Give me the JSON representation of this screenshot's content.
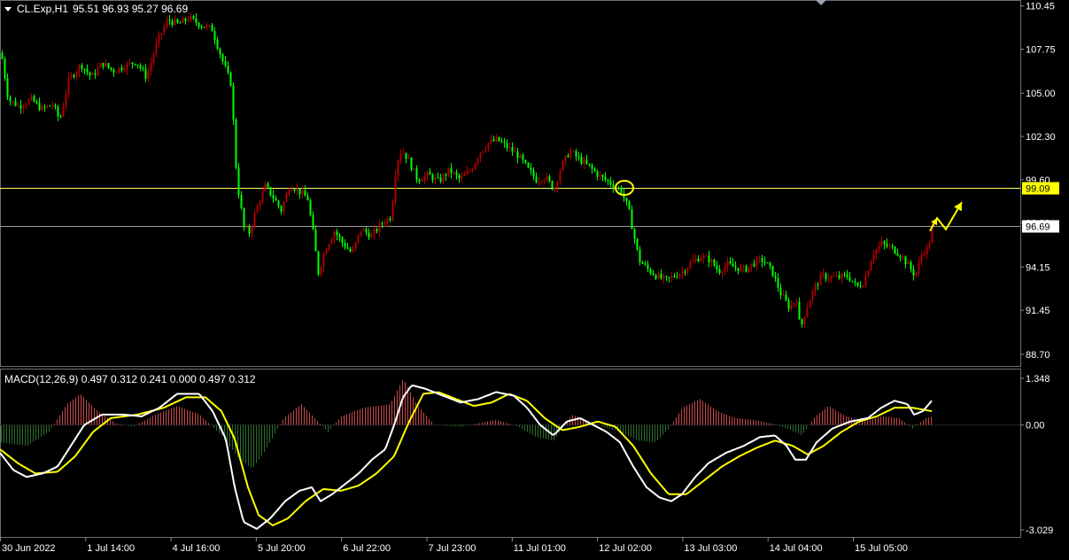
{
  "header": {
    "symbol": "CL.Exp,H1",
    "ohlc": "95.51 96.93 95.27 96.69"
  },
  "colors": {
    "background": "#000000",
    "grid": "#5a5a5a",
    "bull_candle": "#b00000",
    "bear_candle": "#00ff00",
    "macd_line": "#ffffff",
    "signal_line": "#ffff00",
    "hist_positive": "#c84848",
    "hist_negative": "#2c6e2c",
    "level_line": "#ffff66",
    "current_price_line": "#9a9a9a",
    "annotation": "#ffff00"
  },
  "chart_data": [
    {
      "type": "candlestick",
      "name": "price",
      "price_axis": {
        "ticks": [
          "110.45",
          "107.75",
          "105.00",
          "102.30",
          "99.60",
          "96.90",
          "94.15",
          "91.45",
          "88.70"
        ],
        "ylim": [
          88.25,
          110.6
        ]
      },
      "time_axis": {
        "ticks": [
          "30 Jun 2022",
          "1 Jul 14:00",
          "4 Jul 16:00",
          "5 Jul 20:00",
          "6 Jul 22:00",
          "7 Jul 23:00",
          "11 Jul 01:00",
          "12 Jul 02:00",
          "13 Jul 03:00",
          "14 Jul 04:00",
          "15 Jul 05:00"
        ]
      },
      "levels": [
        {
          "price": 99.09,
          "label": "99.09",
          "style": "yellow"
        },
        {
          "price": 96.69,
          "label": "96.69",
          "style": "current"
        }
      ],
      "anchors": [
        {
          "x": 0,
          "y": 107.5
        },
        {
          "x": 8,
          "y": 104.6
        },
        {
          "x": 20,
          "y": 104.2
        },
        {
          "x": 34,
          "y": 104.6
        },
        {
          "x": 46,
          "y": 104.0
        },
        {
          "x": 58,
          "y": 104.3
        },
        {
          "x": 66,
          "y": 103.3
        },
        {
          "x": 76,
          "y": 105.8
        },
        {
          "x": 90,
          "y": 106.8
        },
        {
          "x": 102,
          "y": 106.0
        },
        {
          "x": 114,
          "y": 106.9
        },
        {
          "x": 126,
          "y": 106.4
        },
        {
          "x": 140,
          "y": 106.7
        },
        {
          "x": 152,
          "y": 107.0
        },
        {
          "x": 164,
          "y": 106.0
        },
        {
          "x": 176,
          "y": 108.2
        },
        {
          "x": 188,
          "y": 109.6
        },
        {
          "x": 200,
          "y": 109.3
        },
        {
          "x": 212,
          "y": 109.7
        },
        {
          "x": 224,
          "y": 109.3
        },
        {
          "x": 238,
          "y": 109.0
        },
        {
          "x": 250,
          "y": 107.0
        },
        {
          "x": 260,
          "y": 105.5
        },
        {
          "x": 264,
          "y": 101.0
        },
        {
          "x": 268,
          "y": 98.8
        },
        {
          "x": 274,
          "y": 96.6
        },
        {
          "x": 280,
          "y": 96.3
        },
        {
          "x": 288,
          "y": 97.8
        },
        {
          "x": 298,
          "y": 99.2
        },
        {
          "x": 306,
          "y": 98.6
        },
        {
          "x": 316,
          "y": 97.7
        },
        {
          "x": 326,
          "y": 99.3
        },
        {
          "x": 336,
          "y": 98.9
        },
        {
          "x": 346,
          "y": 98.4
        },
        {
          "x": 352,
          "y": 96.3
        },
        {
          "x": 358,
          "y": 93.8
        },
        {
          "x": 366,
          "y": 95.3
        },
        {
          "x": 376,
          "y": 96.4
        },
        {
          "x": 386,
          "y": 95.6
        },
        {
          "x": 396,
          "y": 95.0
        },
        {
          "x": 406,
          "y": 96.5
        },
        {
          "x": 418,
          "y": 96.1
        },
        {
          "x": 430,
          "y": 96.9
        },
        {
          "x": 440,
          "y": 97.3
        },
        {
          "x": 446,
          "y": 100.6
        },
        {
          "x": 452,
          "y": 101.5
        },
        {
          "x": 460,
          "y": 100.8
        },
        {
          "x": 470,
          "y": 99.6
        },
        {
          "x": 482,
          "y": 99.9
        },
        {
          "x": 494,
          "y": 99.5
        },
        {
          "x": 506,
          "y": 100.2
        },
        {
          "x": 518,
          "y": 99.6
        },
        {
          "x": 530,
          "y": 100.2
        },
        {
          "x": 540,
          "y": 101.3
        },
        {
          "x": 550,
          "y": 101.9
        },
        {
          "x": 560,
          "y": 102.1
        },
        {
          "x": 572,
          "y": 101.6
        },
        {
          "x": 584,
          "y": 101.1
        },
        {
          "x": 594,
          "y": 100.3
        },
        {
          "x": 604,
          "y": 99.6
        },
        {
          "x": 614,
          "y": 99.8
        },
        {
          "x": 624,
          "y": 99.0
        },
        {
          "x": 632,
          "y": 100.4
        },
        {
          "x": 642,
          "y": 101.4
        },
        {
          "x": 652,
          "y": 100.9
        },
        {
          "x": 664,
          "y": 100.4
        },
        {
          "x": 676,
          "y": 99.8
        },
        {
          "x": 688,
          "y": 99.4
        },
        {
          "x": 700,
          "y": 98.9
        },
        {
          "x": 708,
          "y": 97.8
        },
        {
          "x": 714,
          "y": 96.2
        },
        {
          "x": 720,
          "y": 94.6
        },
        {
          "x": 730,
          "y": 94.0
        },
        {
          "x": 740,
          "y": 93.6
        },
        {
          "x": 750,
          "y": 93.3
        },
        {
          "x": 760,
          "y": 93.6
        },
        {
          "x": 770,
          "y": 93.9
        },
        {
          "x": 780,
          "y": 94.5
        },
        {
          "x": 790,
          "y": 94.8
        },
        {
          "x": 800,
          "y": 94.6
        },
        {
          "x": 810,
          "y": 93.9
        },
        {
          "x": 820,
          "y": 94.3
        },
        {
          "x": 830,
          "y": 94.1
        },
        {
          "x": 840,
          "y": 94.0
        },
        {
          "x": 850,
          "y": 94.4
        },
        {
          "x": 860,
          "y": 94.6
        },
        {
          "x": 870,
          "y": 93.9
        },
        {
          "x": 880,
          "y": 92.5
        },
        {
          "x": 890,
          "y": 91.6
        },
        {
          "x": 898,
          "y": 92.2
        },
        {
          "x": 902,
          "y": 90.2
        },
        {
          "x": 908,
          "y": 91.4
        },
        {
          "x": 916,
          "y": 92.6
        },
        {
          "x": 926,
          "y": 93.6
        },
        {
          "x": 936,
          "y": 93.5
        },
        {
          "x": 946,
          "y": 93.5
        },
        {
          "x": 956,
          "y": 93.6
        },
        {
          "x": 966,
          "y": 92.9
        },
        {
          "x": 974,
          "y": 93.2
        },
        {
          "x": 984,
          "y": 95.0
        },
        {
          "x": 994,
          "y": 95.6
        },
        {
          "x": 1006,
          "y": 95.3
        },
        {
          "x": 1016,
          "y": 94.9
        },
        {
          "x": 1026,
          "y": 94.1
        },
        {
          "x": 1032,
          "y": 93.6
        },
        {
          "x": 1040,
          "y": 95.1
        },
        {
          "x": 1046,
          "y": 95.3
        },
        {
          "x": 1052,
          "y": 96.69
        }
      ],
      "forecast_arrow": [
        {
          "x": 1050,
          "y": 96.4
        },
        {
          "x": 1058,
          "y": 97.2
        },
        {
          "x": 1068,
          "y": 96.5
        },
        {
          "x": 1086,
          "y": 98.2
        }
      ],
      "highlight_circle": {
        "x": 705,
        "y": 99.09
      }
    },
    {
      "type": "macd",
      "label": "MACD(12,26,9) 0.497 0.312 0.241 0.000 0.497 0.312",
      "params": [
        12,
        26,
        9
      ],
      "values": {
        "macd": 0.497,
        "signal": 0.312,
        "histogram": 0.241,
        "zero": 0.0
      },
      "y_axis": {
        "ticks": [
          "1.348",
          "0.00",
          "-3.029"
        ],
        "ylim": [
          -3.029,
          1.348
        ]
      },
      "macd_points": [
        {
          "x": 0,
          "y": -0.8
        },
        {
          "x": 15,
          "y": -1.3
        },
        {
          "x": 30,
          "y": -1.5
        },
        {
          "x": 48,
          "y": -1.4
        },
        {
          "x": 65,
          "y": -1.2
        },
        {
          "x": 80,
          "y": -0.6
        },
        {
          "x": 95,
          "y": 0.0
        },
        {
          "x": 115,
          "y": 0.3
        },
        {
          "x": 140,
          "y": 0.3
        },
        {
          "x": 160,
          "y": 0.25
        },
        {
          "x": 180,
          "y": 0.5
        },
        {
          "x": 200,
          "y": 0.9
        },
        {
          "x": 225,
          "y": 0.9
        },
        {
          "x": 240,
          "y": 0.4
        },
        {
          "x": 255,
          "y": -0.4
        },
        {
          "x": 265,
          "y": -1.8
        },
        {
          "x": 275,
          "y": -2.8
        },
        {
          "x": 290,
          "y": -3.0
        },
        {
          "x": 305,
          "y": -2.7
        },
        {
          "x": 322,
          "y": -2.2
        },
        {
          "x": 338,
          "y": -1.9
        },
        {
          "x": 352,
          "y": -1.8
        },
        {
          "x": 362,
          "y": -2.2
        },
        {
          "x": 375,
          "y": -2.0
        },
        {
          "x": 390,
          "y": -1.7
        },
        {
          "x": 405,
          "y": -1.4
        },
        {
          "x": 420,
          "y": -1.0
        },
        {
          "x": 435,
          "y": -0.7
        },
        {
          "x": 445,
          "y": 0.0
        },
        {
          "x": 455,
          "y": 0.8
        },
        {
          "x": 465,
          "y": 1.15
        },
        {
          "x": 480,
          "y": 1.05
        },
        {
          "x": 500,
          "y": 0.85
        },
        {
          "x": 520,
          "y": 0.65
        },
        {
          "x": 540,
          "y": 0.75
        },
        {
          "x": 560,
          "y": 0.95
        },
        {
          "x": 580,
          "y": 0.85
        },
        {
          "x": 595,
          "y": 0.5
        },
        {
          "x": 610,
          "y": 0.0
        },
        {
          "x": 625,
          "y": -0.3
        },
        {
          "x": 640,
          "y": 0.1
        },
        {
          "x": 655,
          "y": 0.2
        },
        {
          "x": 670,
          "y": 0.0
        },
        {
          "x": 685,
          "y": -0.2
        },
        {
          "x": 700,
          "y": -0.5
        },
        {
          "x": 715,
          "y": -1.2
        },
        {
          "x": 730,
          "y": -1.8
        },
        {
          "x": 745,
          "y": -2.1
        },
        {
          "x": 758,
          "y": -2.2
        },
        {
          "x": 770,
          "y": -2.0
        },
        {
          "x": 785,
          "y": -1.5
        },
        {
          "x": 800,
          "y": -1.1
        },
        {
          "x": 820,
          "y": -0.8
        },
        {
          "x": 840,
          "y": -0.6
        },
        {
          "x": 858,
          "y": -0.35
        },
        {
          "x": 875,
          "y": -0.3
        },
        {
          "x": 888,
          "y": -0.6
        },
        {
          "x": 898,
          "y": -1.0
        },
        {
          "x": 910,
          "y": -1.0
        },
        {
          "x": 922,
          "y": -0.5
        },
        {
          "x": 940,
          "y": -0.1
        },
        {
          "x": 960,
          "y": 0.1
        },
        {
          "x": 980,
          "y": 0.2
        },
        {
          "x": 995,
          "y": 0.5
        },
        {
          "x": 1010,
          "y": 0.7
        },
        {
          "x": 1025,
          "y": 0.6
        },
        {
          "x": 1032,
          "y": 0.3
        },
        {
          "x": 1042,
          "y": 0.4
        },
        {
          "x": 1052,
          "y": 0.7
        }
      ],
      "signal_points": [
        {
          "x": 0,
          "y": -0.7
        },
        {
          "x": 20,
          "y": -1.1
        },
        {
          "x": 40,
          "y": -1.4
        },
        {
          "x": 65,
          "y": -1.35
        },
        {
          "x": 85,
          "y": -0.9
        },
        {
          "x": 105,
          "y": -0.2
        },
        {
          "x": 125,
          "y": 0.2
        },
        {
          "x": 155,
          "y": 0.3
        },
        {
          "x": 185,
          "y": 0.5
        },
        {
          "x": 210,
          "y": 0.8
        },
        {
          "x": 232,
          "y": 0.8
        },
        {
          "x": 250,
          "y": 0.4
        },
        {
          "x": 265,
          "y": -0.4
        },
        {
          "x": 280,
          "y": -1.8
        },
        {
          "x": 292,
          "y": -2.6
        },
        {
          "x": 308,
          "y": -2.9
        },
        {
          "x": 325,
          "y": -2.7
        },
        {
          "x": 345,
          "y": -2.2
        },
        {
          "x": 365,
          "y": -1.85
        },
        {
          "x": 385,
          "y": -1.9
        },
        {
          "x": 405,
          "y": -1.75
        },
        {
          "x": 425,
          "y": -1.4
        },
        {
          "x": 445,
          "y": -0.9
        },
        {
          "x": 462,
          "y": 0.1
        },
        {
          "x": 478,
          "y": 0.9
        },
        {
          "x": 495,
          "y": 0.95
        },
        {
          "x": 515,
          "y": 0.75
        },
        {
          "x": 535,
          "y": 0.55
        },
        {
          "x": 555,
          "y": 0.65
        },
        {
          "x": 575,
          "y": 0.9
        },
        {
          "x": 595,
          "y": 0.7
        },
        {
          "x": 615,
          "y": 0.2
        },
        {
          "x": 635,
          "y": -0.15
        },
        {
          "x": 655,
          "y": -0.05
        },
        {
          "x": 675,
          "y": 0.1
        },
        {
          "x": 695,
          "y": -0.05
        },
        {
          "x": 715,
          "y": -0.6
        },
        {
          "x": 735,
          "y": -1.4
        },
        {
          "x": 755,
          "y": -2.0
        },
        {
          "x": 775,
          "y": -2.0
        },
        {
          "x": 795,
          "y": -1.6
        },
        {
          "x": 815,
          "y": -1.2
        },
        {
          "x": 835,
          "y": -0.9
        },
        {
          "x": 855,
          "y": -0.65
        },
        {
          "x": 875,
          "y": -0.45
        },
        {
          "x": 895,
          "y": -0.6
        },
        {
          "x": 912,
          "y": -0.85
        },
        {
          "x": 930,
          "y": -0.6
        },
        {
          "x": 950,
          "y": -0.2
        },
        {
          "x": 970,
          "y": 0.1
        },
        {
          "x": 990,
          "y": 0.25
        },
        {
          "x": 1010,
          "y": 0.5
        },
        {
          "x": 1030,
          "y": 0.5
        },
        {
          "x": 1052,
          "y": 0.4
        }
      ],
      "histogram_points": [
        {
          "x": 0,
          "y": -0.5
        },
        {
          "x": 30,
          "y": -0.6
        },
        {
          "x": 55,
          "y": -0.2
        },
        {
          "x": 75,
          "y": 0.6
        },
        {
          "x": 90,
          "y": 0.9
        },
        {
          "x": 110,
          "y": 0.4
        },
        {
          "x": 130,
          "y": 0.05
        },
        {
          "x": 150,
          "y": -0.05
        },
        {
          "x": 175,
          "y": 0.3
        },
        {
          "x": 200,
          "y": 0.55
        },
        {
          "x": 225,
          "y": 0.3
        },
        {
          "x": 250,
          "y": -0.3
        },
        {
          "x": 270,
          "y": -1.0
        },
        {
          "x": 285,
          "y": -1.25
        },
        {
          "x": 300,
          "y": -0.7
        },
        {
          "x": 320,
          "y": 0.2
        },
        {
          "x": 340,
          "y": 0.6
        },
        {
          "x": 355,
          "y": 0.2
        },
        {
          "x": 370,
          "y": -0.2
        },
        {
          "x": 385,
          "y": 0.25
        },
        {
          "x": 410,
          "y": 0.5
        },
        {
          "x": 440,
          "y": 0.6
        },
        {
          "x": 455,
          "y": 1.35
        },
        {
          "x": 470,
          "y": 0.6
        },
        {
          "x": 490,
          "y": 0.0
        },
        {
          "x": 520,
          "y": -0.05
        },
        {
          "x": 540,
          "y": 0.05
        },
        {
          "x": 560,
          "y": 0.15
        },
        {
          "x": 585,
          "y": -0.05
        },
        {
          "x": 605,
          "y": -0.35
        },
        {
          "x": 625,
          "y": -0.45
        },
        {
          "x": 645,
          "y": 0.3
        },
        {
          "x": 660,
          "y": 0.15
        },
        {
          "x": 680,
          "y": -0.05
        },
        {
          "x": 700,
          "y": -0.2
        },
        {
          "x": 720,
          "y": -0.45
        },
        {
          "x": 740,
          "y": -0.5
        },
        {
          "x": 755,
          "y": -0.1
        },
        {
          "x": 770,
          "y": 0.5
        },
        {
          "x": 790,
          "y": 0.75
        },
        {
          "x": 810,
          "y": 0.4
        },
        {
          "x": 830,
          "y": 0.2
        },
        {
          "x": 850,
          "y": 0.15
        },
        {
          "x": 870,
          "y": 0.05
        },
        {
          "x": 888,
          "y": -0.1
        },
        {
          "x": 905,
          "y": -0.3
        },
        {
          "x": 920,
          "y": 0.25
        },
        {
          "x": 935,
          "y": 0.55
        },
        {
          "x": 955,
          "y": 0.25
        },
        {
          "x": 975,
          "y": 0.1
        },
        {
          "x": 995,
          "y": 0.25
        },
        {
          "x": 1015,
          "y": 0.2
        },
        {
          "x": 1030,
          "y": -0.1
        },
        {
          "x": 1045,
          "y": 0.2
        },
        {
          "x": 1052,
          "y": 0.24
        }
      ]
    }
  ]
}
